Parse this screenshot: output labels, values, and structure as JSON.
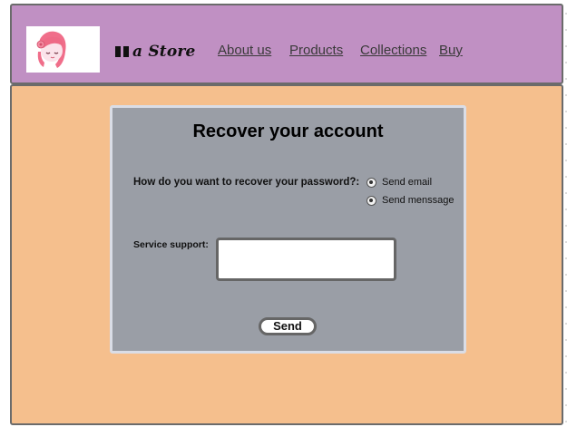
{
  "header": {
    "brand_name": "a Store",
    "logo_icon": "girl-face-logo",
    "nav": [
      {
        "label": "About us"
      },
      {
        "label": "Products"
      },
      {
        "label": "Collections"
      },
      {
        "label": "Buy"
      }
    ]
  },
  "recover": {
    "title": "Recover your account",
    "question": "How do you want to recover your password?:",
    "options": [
      {
        "label": "Send email"
      },
      {
        "label": "Send menssage"
      }
    ],
    "support_label": "Service support:",
    "support_value": "",
    "send_label": "Send"
  },
  "colors": {
    "header_bg": "#c090c3",
    "main_bg": "#f5bf8d",
    "card_bg": "#9a9ea6",
    "card_border": "#dadde6"
  }
}
